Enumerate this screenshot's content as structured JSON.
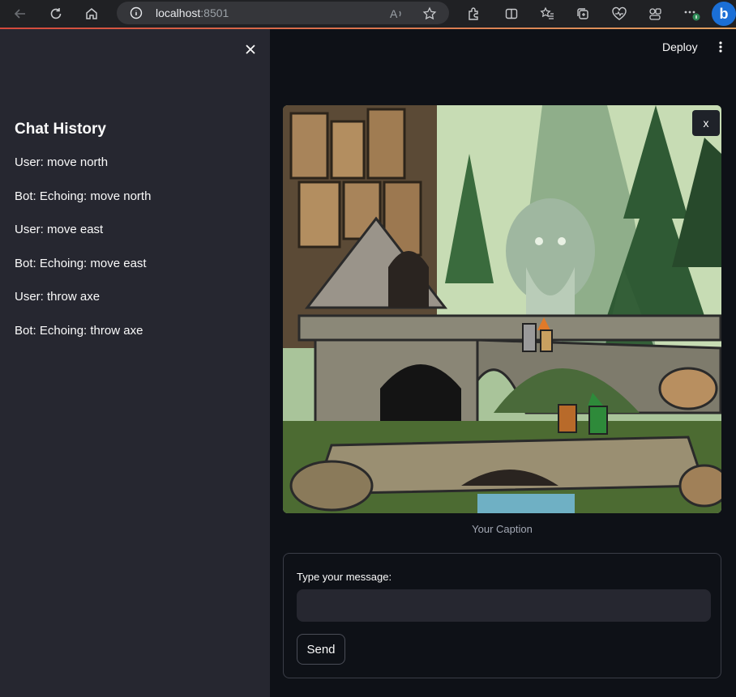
{
  "browser": {
    "host": "localhost",
    "port": ":8501",
    "bing_label": "b"
  },
  "header": {
    "deploy_label": "Deploy"
  },
  "sidebar": {
    "title": "Chat History",
    "messages": [
      "User: move north",
      "Bot: Echoing: move north",
      "User: move east",
      "Bot: Echoing: move east",
      "User: throw axe",
      "Bot: Echoing: throw axe"
    ]
  },
  "main": {
    "image_close_label": "x",
    "caption": "Your Caption",
    "form": {
      "label": "Type your message:",
      "input_value": "",
      "input_placeholder": "",
      "send_label": "Send"
    }
  },
  "colors": {
    "sidebar_bg": "#262730",
    "main_bg": "#0e1117",
    "text": "#fafafa"
  }
}
